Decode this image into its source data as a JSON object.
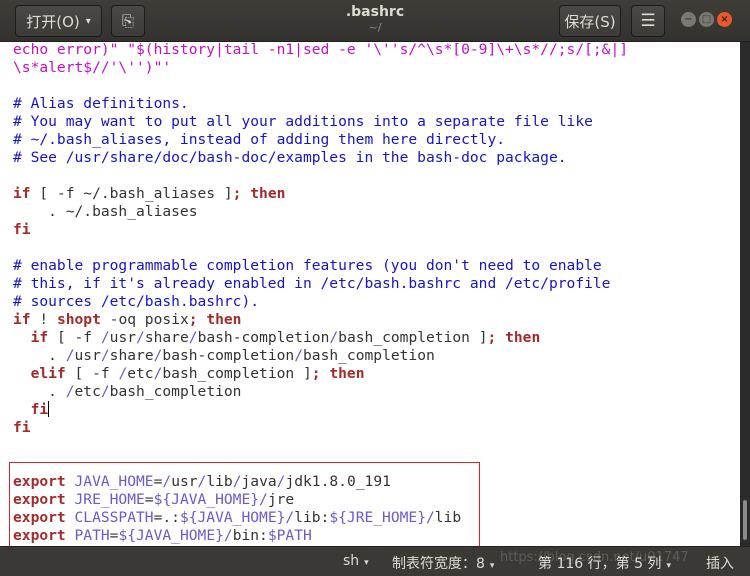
{
  "header": {
    "open_label": "打开(O)",
    "caret": "▾",
    "newtab_icon": "⎘",
    "title": ".bashrc",
    "subtitle": "~/",
    "save_label": "保存(S)",
    "menu_icon": "☰",
    "min_icon": "−",
    "max_icon": "□",
    "close_icon": "×"
  },
  "editor": {
    "lines": [
      [
        {
          "t": "echo error)\" \"$(history|tail -n1|sed -e '\\''s/^\\s*[0-9]\\+\\s*//;s/[;&|]",
          "c": "str"
        }
      ],
      [
        {
          "t": "\\s*alert$//'\\'')\"'",
          "c": "str"
        }
      ],
      [],
      [
        {
          "t": "# Alias definitions.",
          "c": "com"
        }
      ],
      [
        {
          "t": "# You may want to put all your additions into a separate file like",
          "c": "com"
        }
      ],
      [
        {
          "t": "# ~/.bash_aliases, instead of adding them here directly.",
          "c": "com"
        }
      ],
      [
        {
          "t": "# See /usr/share/doc/bash-doc/examples in the bash-doc package.",
          "c": "com"
        }
      ],
      [],
      [
        {
          "t": "if",
          "c": "kw"
        },
        {
          "t": " [ -f ~/.bash_aliases ]",
          "c": "txt"
        },
        {
          "t": "; then",
          "c": "kw"
        }
      ],
      [
        {
          "t": "    . ~/.bash_aliases",
          "c": "txt"
        }
      ],
      [
        {
          "t": "fi",
          "c": "kw"
        }
      ],
      [],
      [
        {
          "t": "# enable programmable completion features (you don't need to enable",
          "c": "com"
        }
      ],
      [
        {
          "t": "# this, if it's already enabled in /etc/bash.bashrc and /etc/profile",
          "c": "com"
        }
      ],
      [
        {
          "t": "# sources /etc/bash.bashrc).",
          "c": "com"
        }
      ],
      [
        {
          "t": "if",
          "c": "kw"
        },
        {
          "t": " ! ",
          "c": "txt"
        },
        {
          "t": "shopt",
          "c": "kw"
        },
        {
          "t": " -oq posix",
          "c": "txt"
        },
        {
          "t": "; then",
          "c": "kw"
        }
      ],
      [
        {
          "t": "  if",
          "c": "kw"
        },
        {
          "t": " [ -f ",
          "c": "txt"
        },
        {
          "t": "/",
          "c": "var"
        },
        {
          "t": "usr",
          "c": "txt"
        },
        {
          "t": "/",
          "c": "var"
        },
        {
          "t": "share",
          "c": "txt"
        },
        {
          "t": "/",
          "c": "var"
        },
        {
          "t": "bash-completion",
          "c": "txt"
        },
        {
          "t": "/",
          "c": "var"
        },
        {
          "t": "bash_completion ]",
          "c": "txt"
        },
        {
          "t": "; then",
          "c": "kw"
        }
      ],
      [
        {
          "t": "    . ",
          "c": "txt"
        },
        {
          "t": "/",
          "c": "var"
        },
        {
          "t": "usr",
          "c": "txt"
        },
        {
          "t": "/",
          "c": "var"
        },
        {
          "t": "share",
          "c": "txt"
        },
        {
          "t": "/",
          "c": "var"
        },
        {
          "t": "bash-completion",
          "c": "txt"
        },
        {
          "t": "/",
          "c": "var"
        },
        {
          "t": "bash_completion",
          "c": "txt"
        }
      ],
      [
        {
          "t": "  elif",
          "c": "kw"
        },
        {
          "t": " [ -f ",
          "c": "txt"
        },
        {
          "t": "/",
          "c": "var"
        },
        {
          "t": "etc",
          "c": "txt"
        },
        {
          "t": "/",
          "c": "var"
        },
        {
          "t": "bash_completion ]",
          "c": "txt"
        },
        {
          "t": "; then",
          "c": "kw"
        }
      ],
      [
        {
          "t": "    . ",
          "c": "txt"
        },
        {
          "t": "/",
          "c": "var"
        },
        {
          "t": "etc",
          "c": "txt"
        },
        {
          "t": "/",
          "c": "var"
        },
        {
          "t": "bash_completion",
          "c": "txt"
        }
      ],
      [
        {
          "t": "  fi",
          "c": "kw"
        },
        {
          "t": "",
          "c": "cursor"
        }
      ],
      [
        {
          "t": "fi",
          "c": "kw"
        }
      ],
      [],
      [],
      [
        {
          "t": "export",
          "c": "kw"
        },
        {
          "t": " JAVA_HOME",
          "c": "var"
        },
        {
          "t": "=",
          "c": "txt"
        },
        {
          "t": "/",
          "c": "var"
        },
        {
          "t": "usr",
          "c": "txt"
        },
        {
          "t": "/",
          "c": "var"
        },
        {
          "t": "lib",
          "c": "txt"
        },
        {
          "t": "/",
          "c": "var"
        },
        {
          "t": "java",
          "c": "txt"
        },
        {
          "t": "/",
          "c": "var"
        },
        {
          "t": "jdk1.8.0_191",
          "c": "txt"
        }
      ],
      [
        {
          "t": "export",
          "c": "kw"
        },
        {
          "t": " JRE_HOME",
          "c": "var"
        },
        {
          "t": "=",
          "c": "txt"
        },
        {
          "t": "${JAVA_HOME}",
          "c": "var"
        },
        {
          "t": "/",
          "c": "var"
        },
        {
          "t": "jre",
          "c": "txt"
        }
      ],
      [
        {
          "t": "export",
          "c": "kw"
        },
        {
          "t": " CLASSPATH",
          "c": "var"
        },
        {
          "t": "=.:",
          "c": "txt"
        },
        {
          "t": "${JAVA_HOME}",
          "c": "var"
        },
        {
          "t": "/",
          "c": "var"
        },
        {
          "t": "lib:",
          "c": "txt"
        },
        {
          "t": "${JRE_HOME}",
          "c": "var"
        },
        {
          "t": "/",
          "c": "var"
        },
        {
          "t": "lib",
          "c": "txt"
        }
      ],
      [
        {
          "t": "export",
          "c": "kw"
        },
        {
          "t": " PATH",
          "c": "var"
        },
        {
          "t": "=",
          "c": "txt"
        },
        {
          "t": "${JAVA_HOME}",
          "c": "var"
        },
        {
          "t": "/",
          "c": "var"
        },
        {
          "t": "bin:",
          "c": "txt"
        },
        {
          "t": "$PATH",
          "c": "var"
        }
      ]
    ]
  },
  "status": {
    "language": "sh",
    "tab_width": "制表符宽度：8",
    "position": "第 116 行，第 5 列",
    "mode": "插入",
    "caret": "▾"
  },
  "watermark": "https://blog.csdn.net/u01747"
}
